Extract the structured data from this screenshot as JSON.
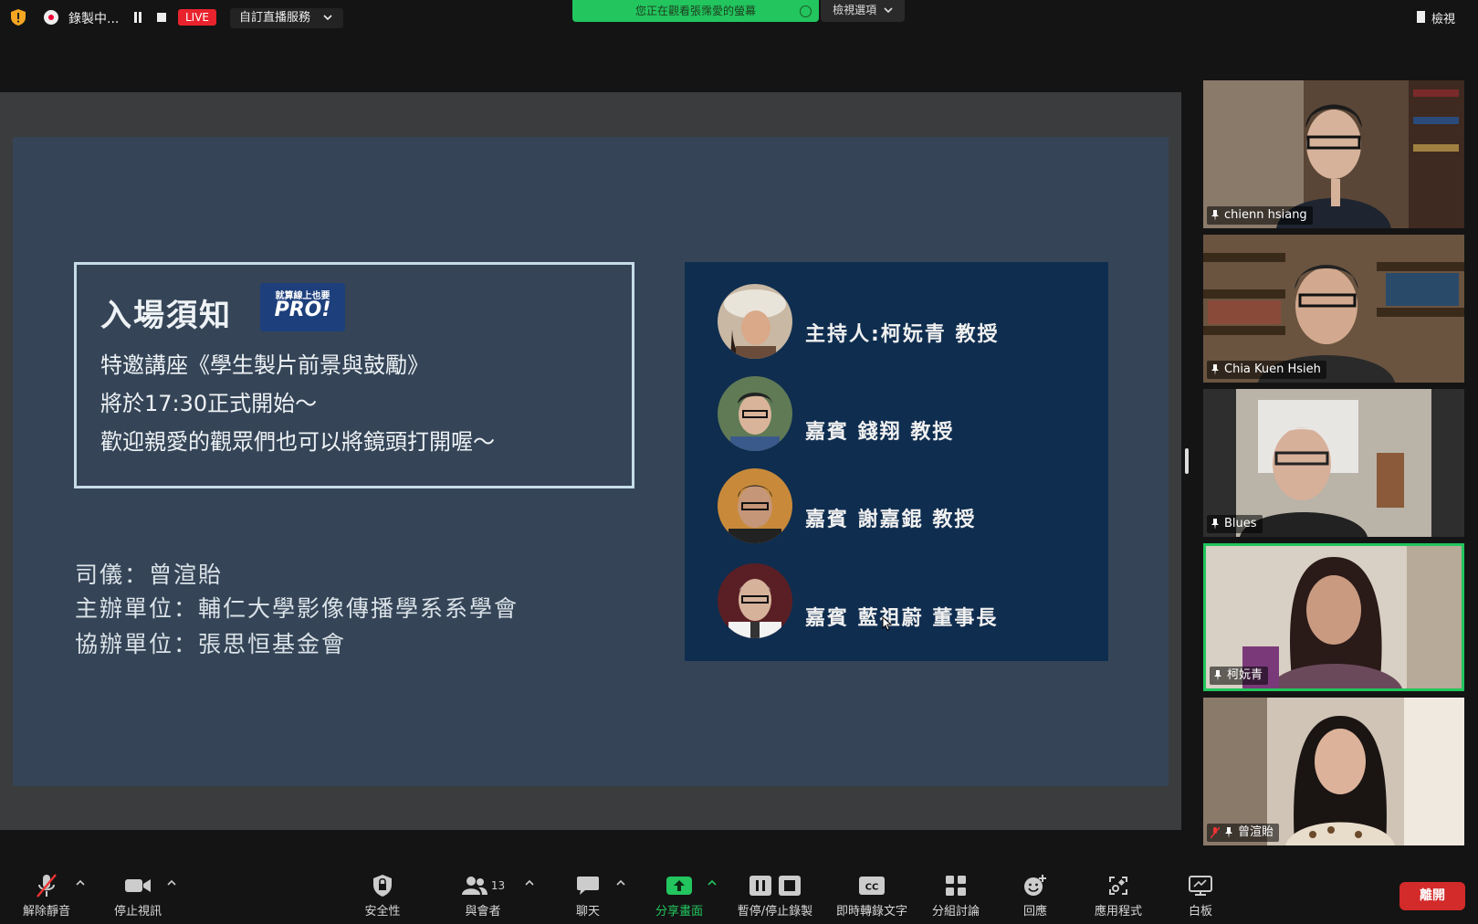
{
  "top_bar": {
    "recording_label": "錄製中...",
    "live_badge": "LIVE",
    "stream_service": "自訂直播服務",
    "viewing_banner": "您正在觀看張霈愛的螢幕",
    "view_options": "檢視選項",
    "view_button": "檢視"
  },
  "slide": {
    "notice_title": "入場須知",
    "badge_small": "就算線上也要",
    "badge_big": "PRO!",
    "notice_lines": [
      "特邀講座《學生製片前景與鼓勵》",
      "將於17:30正式開始～",
      "歡迎親愛的觀眾們也可以將鏡頭打開喔～"
    ],
    "credits": [
      "司儀：曾渲貽",
      "主辦單位：輔仁大學影像傳播學系系學會",
      "協辦單位：張思恒基金會"
    ],
    "guests": [
      "主持人:柯妧青 教授",
      "嘉賓 錢翔 教授",
      "嘉賓 謝嘉錕 教授",
      "嘉賓 藍祖蔚 董事長"
    ]
  },
  "participants": [
    {
      "name": "chienn hsiang",
      "active": false,
      "muted": false
    },
    {
      "name": "Chia Kuen Hsieh",
      "active": false,
      "muted": false
    },
    {
      "name": "Blues",
      "active": false,
      "muted": false
    },
    {
      "name": "柯妧青",
      "active": true,
      "muted": false
    },
    {
      "name": "曾渲貽",
      "active": false,
      "muted": true
    }
  ],
  "toolbar": {
    "unmute": "解除靜音",
    "stop_video": "停止視訊",
    "security": "安全性",
    "participants": "與會者",
    "participant_count": "13",
    "chat": "聊天",
    "share_screen": "分享畫面",
    "pause_stop_recording": "暫停/停止錄製",
    "live_transcript": "即時轉錄文字",
    "breakout_rooms": "分組討論",
    "reactions": "回應",
    "apps": "應用程式",
    "whiteboard": "白板",
    "leave": "離開"
  },
  "colors": {
    "accent_green": "#22c55e",
    "leave_red": "#d32a2a",
    "live_red": "#e8232d",
    "slide_bg": "#354557",
    "guest_panel_bg": "#0f2d4f"
  }
}
